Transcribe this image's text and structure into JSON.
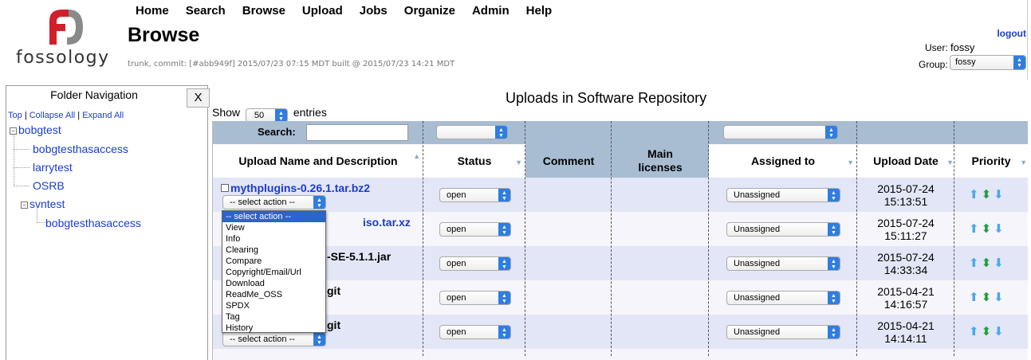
{
  "header": {
    "menu": [
      "Home",
      "Search",
      "Browse",
      "Upload",
      "Jobs",
      "Organize",
      "Admin",
      "Help"
    ],
    "page_title": "Browse",
    "logo_text": "fossology",
    "build_info": "trunk, commit: [#abb949f] 2015/07/23 07:15 MDT built @ 2015/07/23 14:21 MDT",
    "logout": "logout",
    "user_label": "User:",
    "user": "fossy",
    "group_label": "Group:",
    "group": "fossy"
  },
  "folder_nav": {
    "title": "Folder Navigation",
    "close": "X",
    "links": [
      "Top",
      "Collapse All",
      "Expand All"
    ],
    "tree": [
      "bobgtest",
      "bobgtesthasaccess",
      "larrytest",
      "OSRB",
      "svntest",
      "bobgtesthasaccess"
    ]
  },
  "main": {
    "title": "Uploads in Software Repository",
    "show_label": "Show",
    "show_value": "50",
    "entries_label": "entries",
    "search_label": "Search:",
    "columns": [
      "Upload Name and Description",
      "Status",
      "Comment",
      "Main licenses",
      "Assigned to",
      "Upload Date",
      "Priority"
    ],
    "rows": [
      {
        "name": "mythplugins-0.26.1.tar.bz2",
        "status": "open",
        "assigned": "Unassigned",
        "date": "2015-07-24",
        "time": "15:13:51"
      },
      {
        "name": "iso.tar.xz",
        "status": "open",
        "assigned": "Unassigned",
        "date": "2015-07-24",
        "time": "15:11:27"
      },
      {
        "name": "-SE-5.1.1.jar",
        "status": "open",
        "assigned": "Unassigned",
        "date": "2015-07-24",
        "time": "14:33:34"
      },
      {
        "name": "git",
        "status": "open",
        "assigned": "Unassigned",
        "date": "2015-04-21",
        "time": "14:16:57"
      },
      {
        "name": "git",
        "status": "open",
        "assigned": "Unassigned",
        "date": "2015-04-21",
        "time": "14:14:11"
      }
    ],
    "select_action": "-- select action --",
    "action_options": [
      "-- select action --",
      "View",
      "Info",
      "Clearing",
      "Compare",
      "Copyright/Email/Url",
      "Download",
      "ReadMe_OSS",
      "SPDX",
      "Tag",
      "History"
    ]
  },
  "colors": {
    "accent": "#1a3ccf",
    "search_bar": "#a8bcd2",
    "row_odd": "#e2e6f6",
    "logo_red": "#d0202a"
  }
}
